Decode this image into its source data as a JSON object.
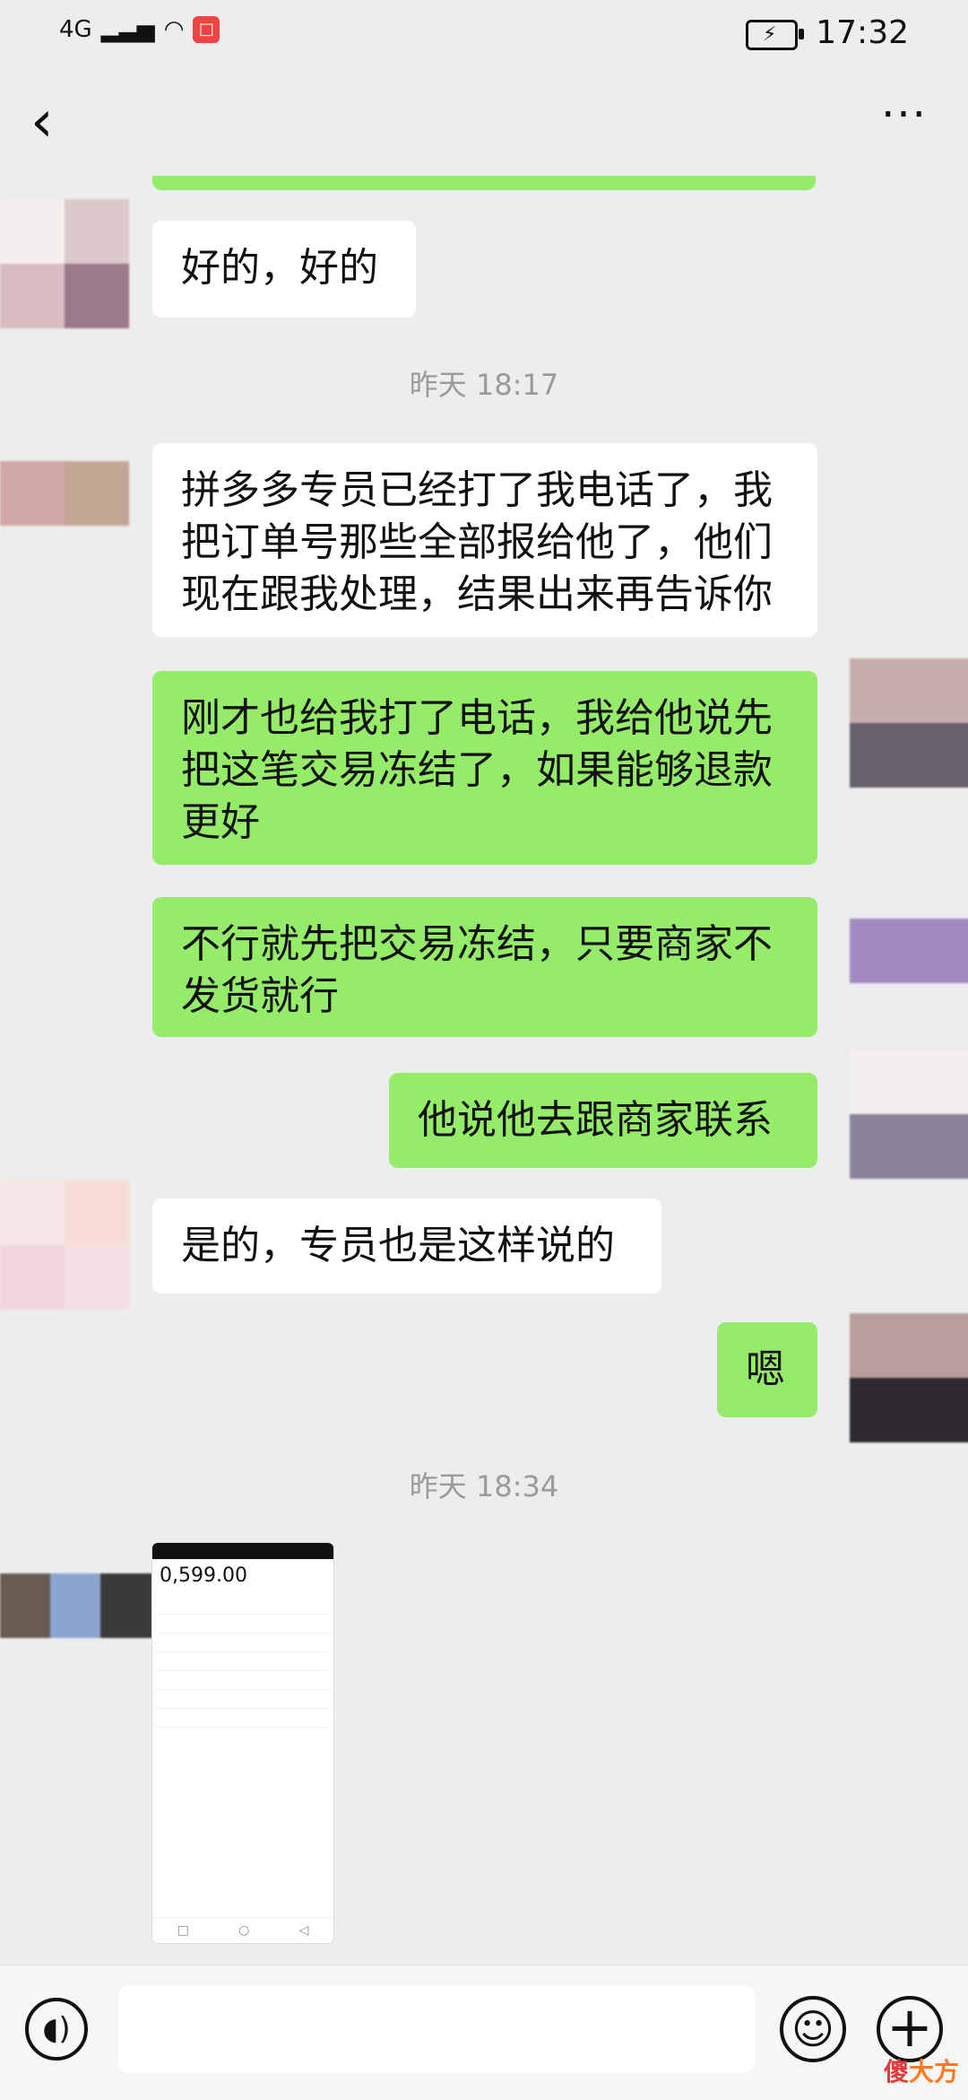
{
  "status_bar": {
    "network": "4G",
    "time": "17:32"
  },
  "nav": {
    "back_icon": "chevron-left-icon",
    "more_label": "···"
  },
  "messages": [
    {
      "id": "m1",
      "side": "in",
      "text": "好的，好的"
    },
    {
      "id": "t1",
      "type": "time",
      "text": "昨天 18:17"
    },
    {
      "id": "m2",
      "side": "in",
      "text": "拼多多专员已经打了我电话了，我把订单号那些全部报给他了，他们现在跟我处理，结果出来再告诉你"
    },
    {
      "id": "m3",
      "side": "out",
      "text": "刚才也给我打了电话，我给他说先把这笔交易冻结了，如果能够退款更好"
    },
    {
      "id": "m4",
      "side": "out",
      "text": "不行就先把交易冻结，只要商家不发货就行"
    },
    {
      "id": "m5",
      "side": "out",
      "text": "他说他去跟商家联系"
    },
    {
      "id": "m6",
      "side": "in",
      "text": "是的，专员也是这样说的"
    },
    {
      "id": "m7",
      "side": "out",
      "text": "嗯"
    },
    {
      "id": "t2",
      "type": "time",
      "text": "昨天 18:34"
    }
  ],
  "image_message": {
    "amount_text": "0,599.00"
  },
  "input_bar": {
    "voice_icon": "voice-icon",
    "emoji_icon": "emoji-icon",
    "plus_icon": "plus-icon",
    "placeholder": ""
  },
  "watermark": {
    "first": "傻",
    "rest": "大方"
  },
  "colors": {
    "out_bubble": "#95ec69",
    "in_bubble": "#ffffff",
    "background": "#ededed"
  }
}
